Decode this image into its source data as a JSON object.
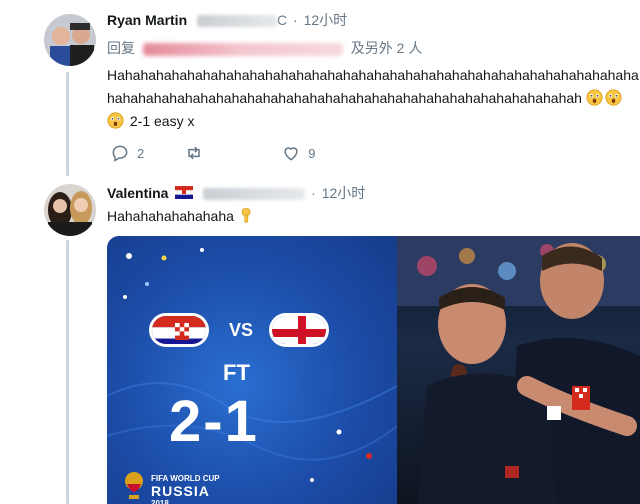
{
  "tweet1": {
    "name": "Ryan Martin",
    "handle_tail": "C",
    "time": "12小时",
    "reply_prefix": "回复",
    "reply_suffix": "及另外 2 人",
    "text_main": "Hahahahahahahahahahahahahahahahahahahahahahahahahahahahahahahahahahahahahahahahahahahahahahahahahahahahahahahahahahahahahahahahah",
    "text_tail": " 2-1 easy x",
    "emoji": [
      "astonished-face-emoji",
      "astonished-face-emoji",
      "astonished-face-emoji"
    ],
    "reply_count": "2",
    "like_count": "9"
  },
  "tweet2": {
    "name": "Valentina",
    "time": "12小时",
    "text": "Hahahahahahahaha",
    "emoji": "pointing-down-emoji"
  },
  "card": {
    "vs": "VS",
    "ft": "FT",
    "score": "2-1",
    "logo_line1": "FIFA WORLD CUP",
    "logo_line2": "RUSSIA",
    "logo_line3": "2018"
  },
  "colors": {
    "thread_line": "#ccd6dd",
    "muted": "#657786",
    "card_blue": "#1c4ca8",
    "croatia_red": "#d52b1e",
    "england_red": "#ce1124"
  }
}
